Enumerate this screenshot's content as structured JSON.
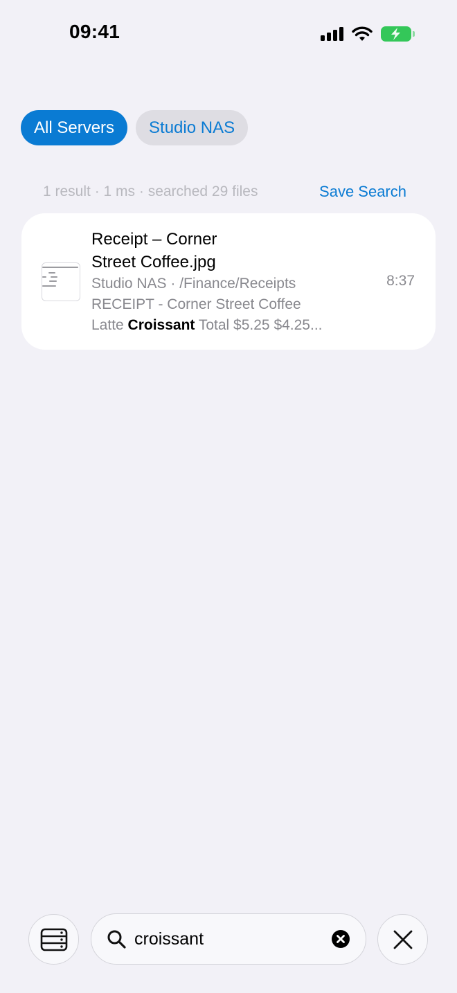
{
  "status_bar": {
    "time": "09:41",
    "icons": [
      "signal-icon",
      "wifi-icon",
      "battery-charging-icon"
    ],
    "battery_color": "#34c759"
  },
  "filters": {
    "all_servers": "All Servers",
    "studio_nas": "Studio NAS",
    "active": "All Servers",
    "accent": "#0a7bd3"
  },
  "results_meta": {
    "summary": "1 result · 1 ms · searched 29 files",
    "save_search": "Save Search"
  },
  "results": [
    {
      "name_line1": "Receipt – Corner",
      "name_line2": "Street Coffee.jpg",
      "location": "Studio NAS · /Finance/Receipts",
      "snippet_line1": "RECEIPT - Corner Street Coffee",
      "snippet_prefix": "Latte ",
      "snippet_match": "Croissant",
      "snippet_suffix": " Total $5.25 $4.25...",
      "time": "8:37"
    }
  ],
  "bottom_bar": {
    "search_value": "croissant",
    "icons": [
      "server-list-icon",
      "search-icon",
      "clear-icon",
      "close-icon"
    ]
  }
}
